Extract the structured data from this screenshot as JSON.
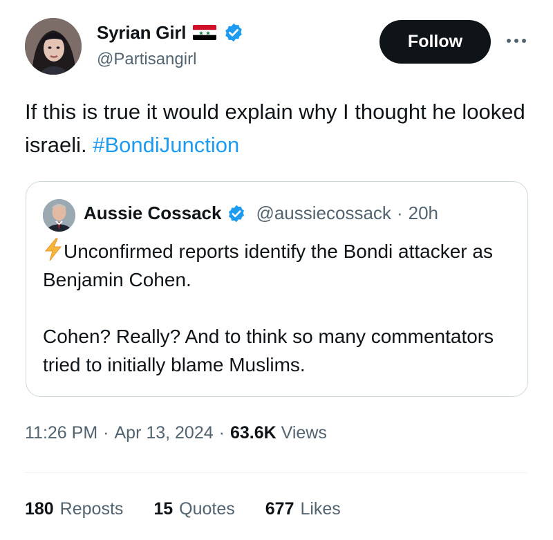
{
  "author": {
    "name": "Syrian Girl",
    "handle": "@Partisangirl",
    "flag_icon": "syria-flag-icon",
    "verified_icon": "verified-badge-icon",
    "verified_color": "#1d9bf0"
  },
  "actions": {
    "follow_label": "Follow",
    "more_icon": "more-options-icon"
  },
  "tweet": {
    "text": "If this is true it would explain why I thought he looked israeli. ",
    "hashtag": "#BondiJunction",
    "hashtag_color": "#1d9bf0"
  },
  "quoted": {
    "name": "Aussie Cossack",
    "handle": "@aussiecossack",
    "separator": "·",
    "time": "20h",
    "bolt_icon": "lightning-bolt-icon",
    "line1": "Unconfirmed reports identify the Bondi attacker as Benjamin Cohen.",
    "line2": "Cohen? Really? And to think so many commentators tried to initially blame Muslims."
  },
  "meta": {
    "time": "11:26 PM",
    "sep1": "·",
    "date": "Apr 13, 2024",
    "sep2": "·",
    "views_count": "63.6K",
    "views_label": "Views"
  },
  "stats": {
    "reposts_count": "180",
    "reposts_label": "Reposts",
    "quotes_count": "15",
    "quotes_label": "Quotes",
    "likes_count": "677",
    "likes_label": "Likes"
  }
}
